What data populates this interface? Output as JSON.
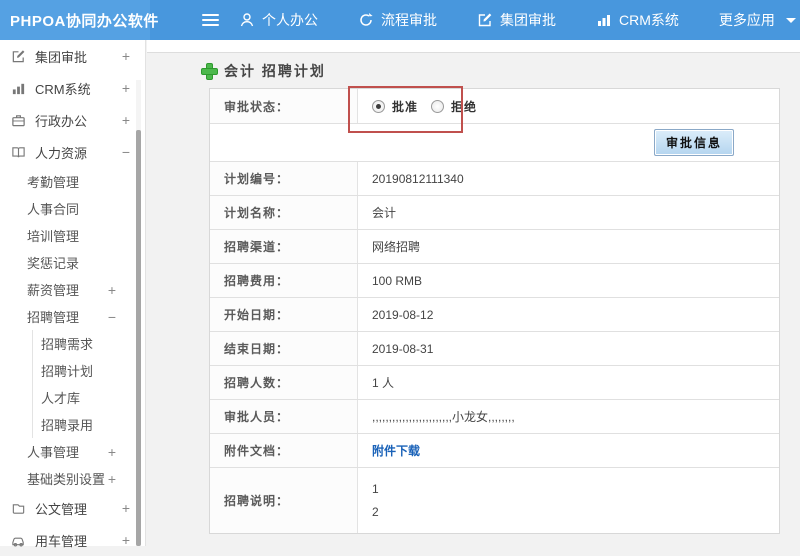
{
  "header": {
    "logo": "PHPOA协同办公软件",
    "nav": [
      {
        "label": "个人办公",
        "icon": "person-icon"
      },
      {
        "label": "流程审批",
        "icon": "process-arrow-icon"
      },
      {
        "label": "集团审批",
        "icon": "edit-square-icon"
      },
      {
        "label": "CRM系统",
        "icon": "bar-chart-icon"
      },
      {
        "label": "更多应用",
        "icon": "chevron-down-icon"
      }
    ]
  },
  "sidebar": {
    "items": [
      {
        "label": "集团审批",
        "icon": "edit-square-icon",
        "expand": "+",
        "level": 1
      },
      {
        "label": "CRM系统",
        "icon": "bar-chart-icon",
        "expand": "+",
        "level": 1
      },
      {
        "label": "行政办公",
        "icon": "briefcase-icon",
        "expand": "+",
        "level": 1
      },
      {
        "label": "人力资源",
        "icon": "book-icon",
        "expand": "−",
        "level": 1
      },
      {
        "label": "考勤管理",
        "level": 2
      },
      {
        "label": "人事合同",
        "level": 2
      },
      {
        "label": "培训管理",
        "level": 2
      },
      {
        "label": "奖惩记录",
        "level": 2
      },
      {
        "label": "薪资管理",
        "expand": "+",
        "level": 2
      },
      {
        "label": "招聘管理",
        "expand": "−",
        "level": 2
      },
      {
        "label": "招聘需求",
        "level": 3
      },
      {
        "label": "招聘计划",
        "level": 3
      },
      {
        "label": "人才库",
        "level": 3
      },
      {
        "label": "招聘录用",
        "level": 3
      },
      {
        "label": "人事管理",
        "expand": "+",
        "level": 2
      },
      {
        "label": "基础类别设置",
        "expand": "+",
        "level": 2
      },
      {
        "label": "公文管理",
        "icon": "document-icon",
        "expand": "+",
        "level": 1
      },
      {
        "label": "用车管理",
        "icon": "car-icon",
        "expand": "+",
        "level": 1
      }
    ]
  },
  "main": {
    "title": "会计 招聘计划",
    "approval": {
      "label": "审批状态：",
      "options": [
        {
          "label": "批准",
          "selected": true
        },
        {
          "label": "拒绝",
          "selected": false
        }
      ]
    },
    "button_label": "审批信息",
    "rows": [
      {
        "label": "计划编号：",
        "value": "20190812111340"
      },
      {
        "label": "计划名称：",
        "value": "会计"
      },
      {
        "label": "招聘渠道：",
        "value": "网络招聘"
      },
      {
        "label": "招聘费用：",
        "value": "100 RMB"
      },
      {
        "label": "开始日期：",
        "value": "2019-08-12"
      },
      {
        "label": "结束日期：",
        "value": "2019-08-31"
      },
      {
        "label": "招聘人数：",
        "value": "1 人"
      },
      {
        "label": "审批人员：",
        "value": ",,,,,,,,,,,,,,,,,,,,,,,,小龙女,,,,,,,,"
      }
    ],
    "attachment": {
      "label": "附件文档：",
      "link": "附件下载"
    },
    "description": {
      "label": "招聘说明：",
      "lines": [
        "1",
        "2"
      ]
    }
  },
  "colors": {
    "header_blue": "#4897dd",
    "logo_blue": "#55a1e3",
    "link_blue": "#1a62b8",
    "annotation_red": "#c0504d",
    "button_blue": "#b4d5ef",
    "plus_green": "#4cb84c"
  }
}
